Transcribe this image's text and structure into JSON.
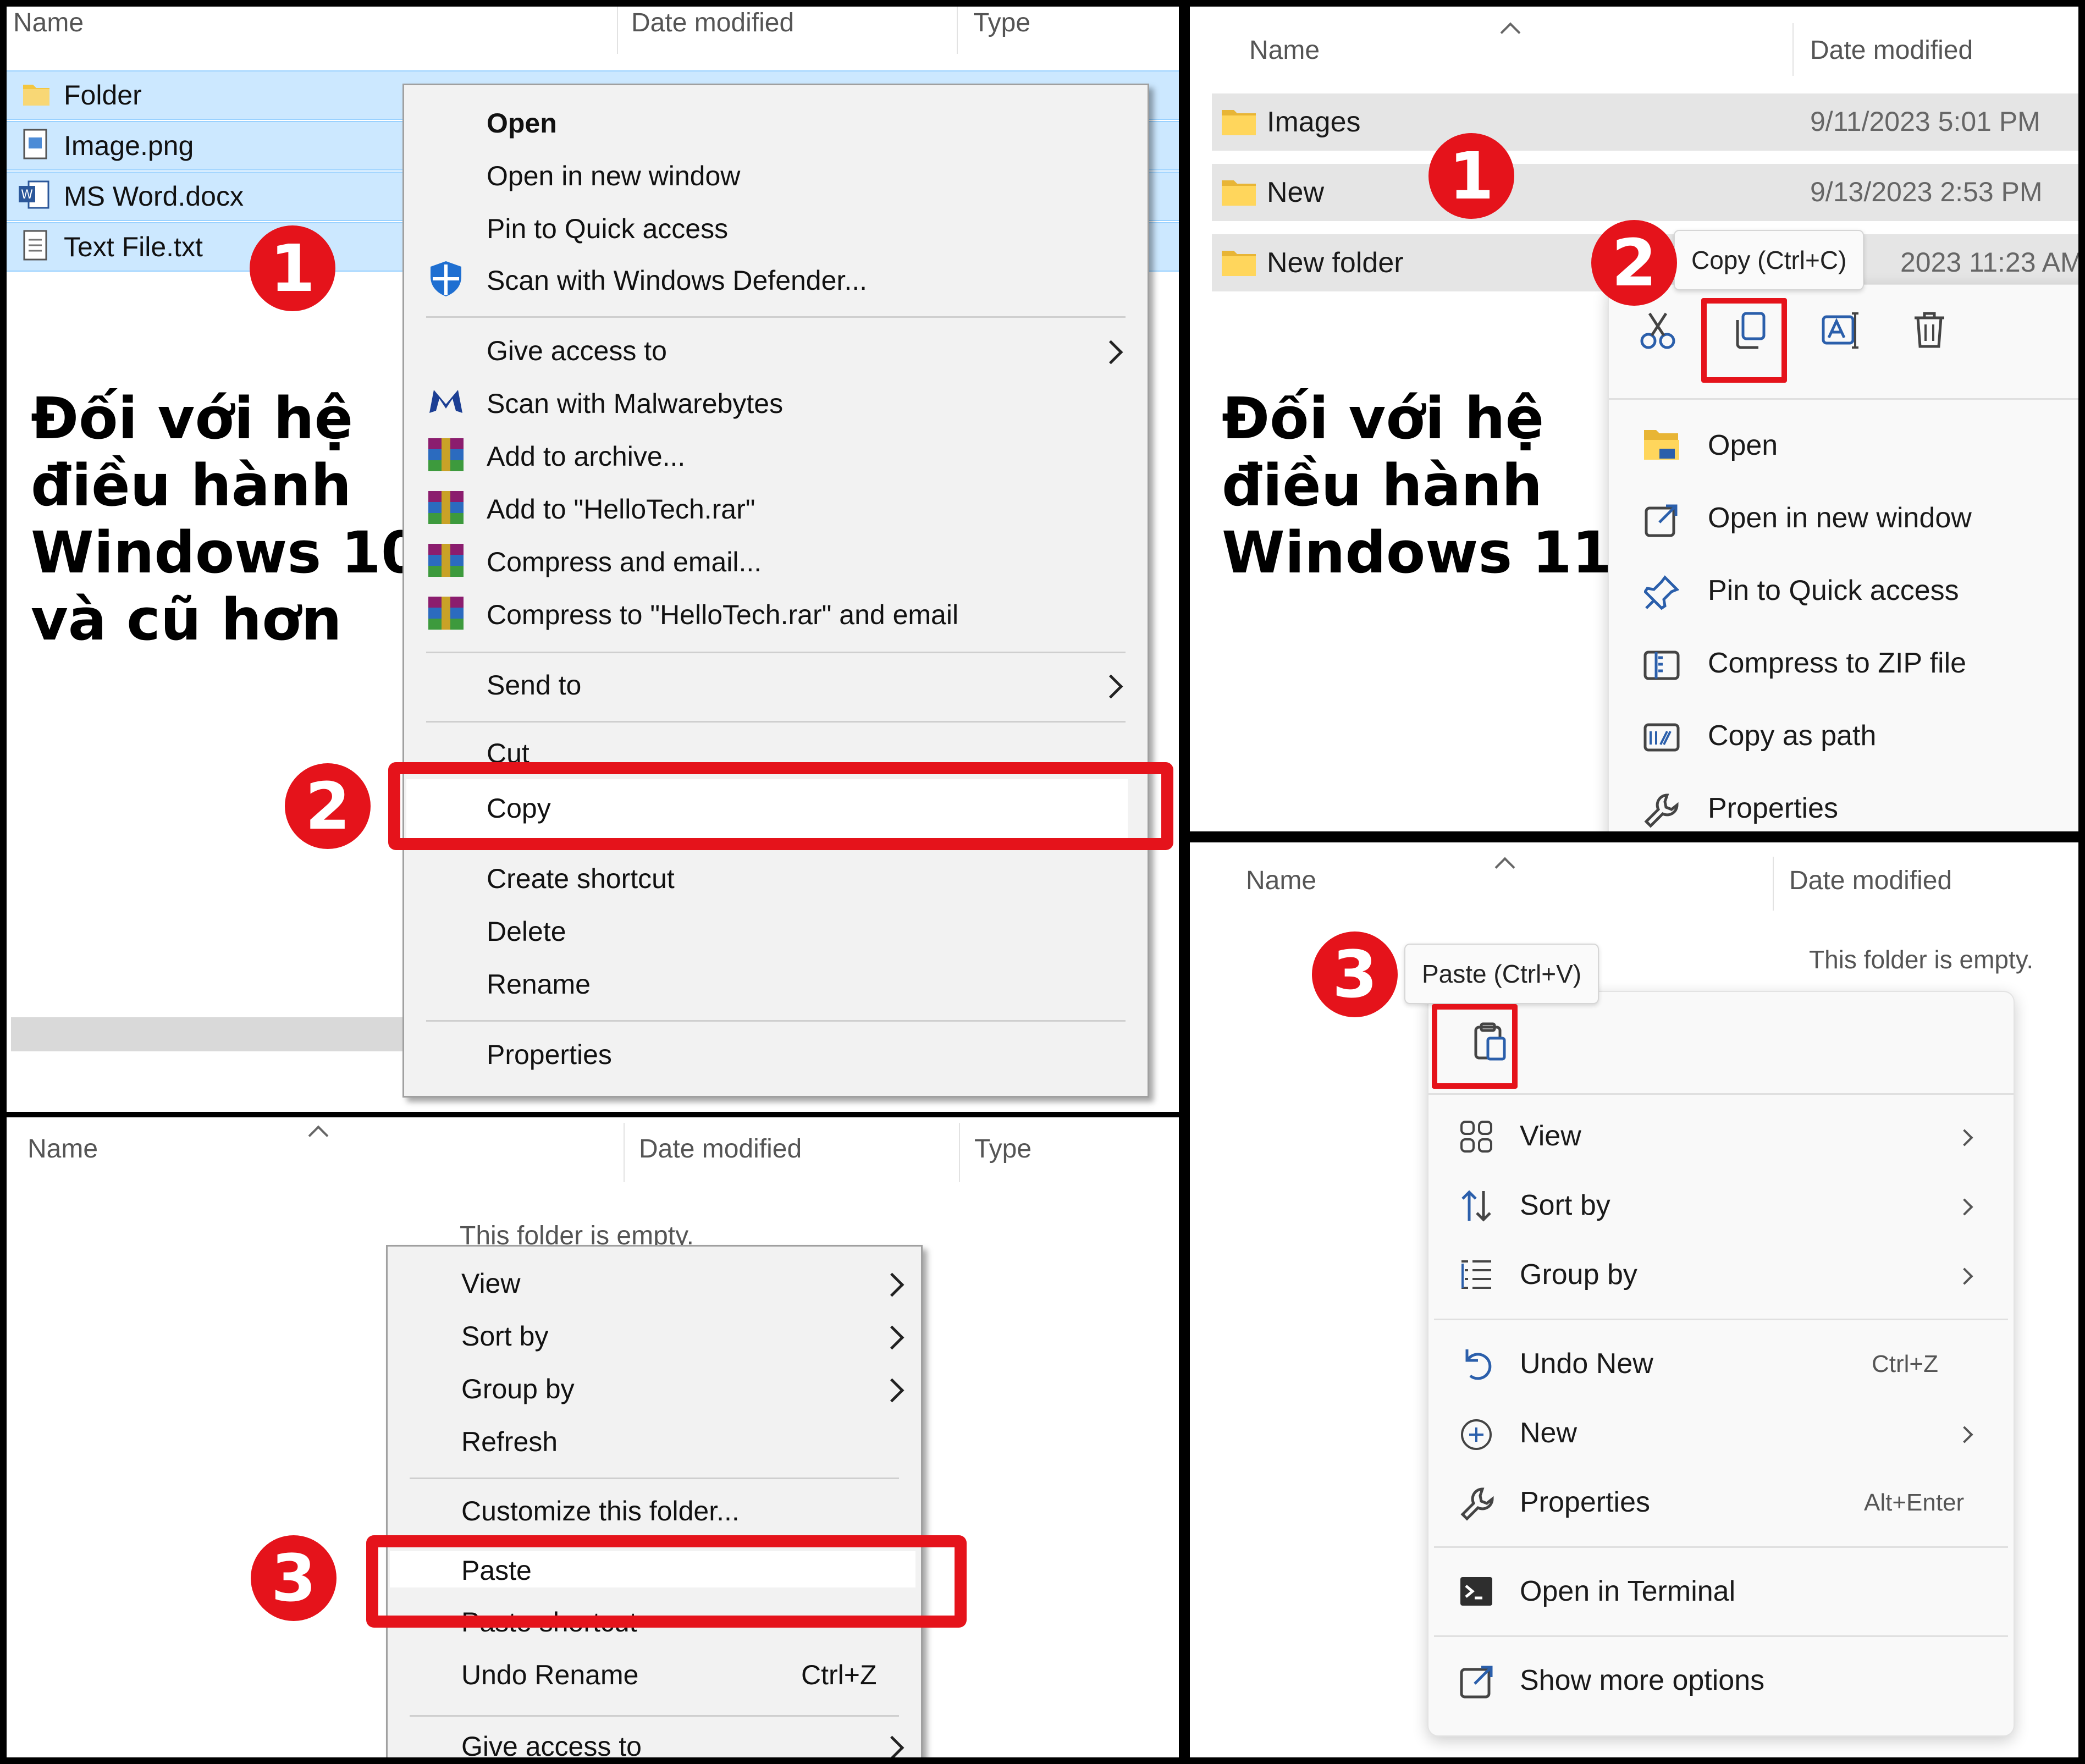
{
  "win10_explorer": {
    "columns": [
      "Name",
      "Date modified",
      "Type"
    ],
    "files": [
      "Folder",
      "Image.png",
      "MS Word.docx",
      "Text File.txt"
    ],
    "caption": [
      "Đối với hệ",
      "điều hành",
      "Windows 10",
      "và cũ hơn"
    ],
    "file_menu": {
      "open": "Open",
      "open_new_window": "Open in new window",
      "pin": "Pin to Quick access",
      "defender": "Scan with Windows Defender...",
      "give_access": "Give access to",
      "malwarebytes": "Scan with Malwarebytes",
      "add_archive": "Add to archive...",
      "add_rar": "Add to \"HelloTech.rar\"",
      "compress_email": "Compress and email...",
      "compress_rar_email": "Compress to \"HelloTech.rar\" and email",
      "send_to": "Send to",
      "cut": "Cut",
      "copy": "Copy",
      "create_shortcut": "Create shortcut",
      "delete": "Delete",
      "rename": "Rename",
      "properties": "Properties"
    },
    "steps": [
      "1",
      "2"
    ]
  },
  "win10_empty": {
    "columns": [
      "Name",
      "Date modified",
      "Type"
    ],
    "empty_text": "This folder is empty.",
    "menu": {
      "view": "View",
      "sort_by": "Sort by",
      "group_by": "Group by",
      "refresh": "Refresh",
      "customize": "Customize this folder...",
      "paste": "Paste",
      "paste_shortcut": "Paste shortcut",
      "undo_rename": "Undo Rename",
      "undo_shortcut": "Ctrl+Z",
      "give_access": "Give access to"
    },
    "step": "3"
  },
  "win11_explorer": {
    "columns": [
      "Name",
      "Date modified"
    ],
    "rows": [
      {
        "name": "Images",
        "date": "9/11/2023 5:01 PM"
      },
      {
        "name": "New",
        "date": "9/13/2023 2:53 PM"
      },
      {
        "name": "New folder",
        "date": "2023 11:23 AM"
      }
    ],
    "caption": [
      "Đối với hệ",
      "điều hành",
      "Windows 11"
    ],
    "tooltip": "Copy (Ctrl+C)",
    "menu": {
      "open": "Open",
      "open_new_window": "Open in new window",
      "pin": "Pin to Quick access",
      "zip": "Compress to ZIP file",
      "copy_path": "Copy as path",
      "properties": "Properties"
    },
    "steps": [
      "1",
      "2"
    ]
  },
  "win11_empty": {
    "columns": [
      "Name",
      "Date modified"
    ],
    "empty_text": "This folder is empty.",
    "tooltip": "Paste (Ctrl+V)",
    "menu": {
      "view": "View",
      "sort_by": "Sort by",
      "group_by": "Group by",
      "undo_new": "Undo New",
      "undo_shortcut": "Ctrl+Z",
      "new": "New",
      "properties": "Properties",
      "properties_shortcut": "Alt+Enter",
      "terminal": "Open in Terminal",
      "more_options": "Show more options"
    },
    "step": "3"
  },
  "colors": {
    "accent_red": "#e5131b",
    "selection": "#cce8ff",
    "win11_row": "#e5e5e5"
  }
}
